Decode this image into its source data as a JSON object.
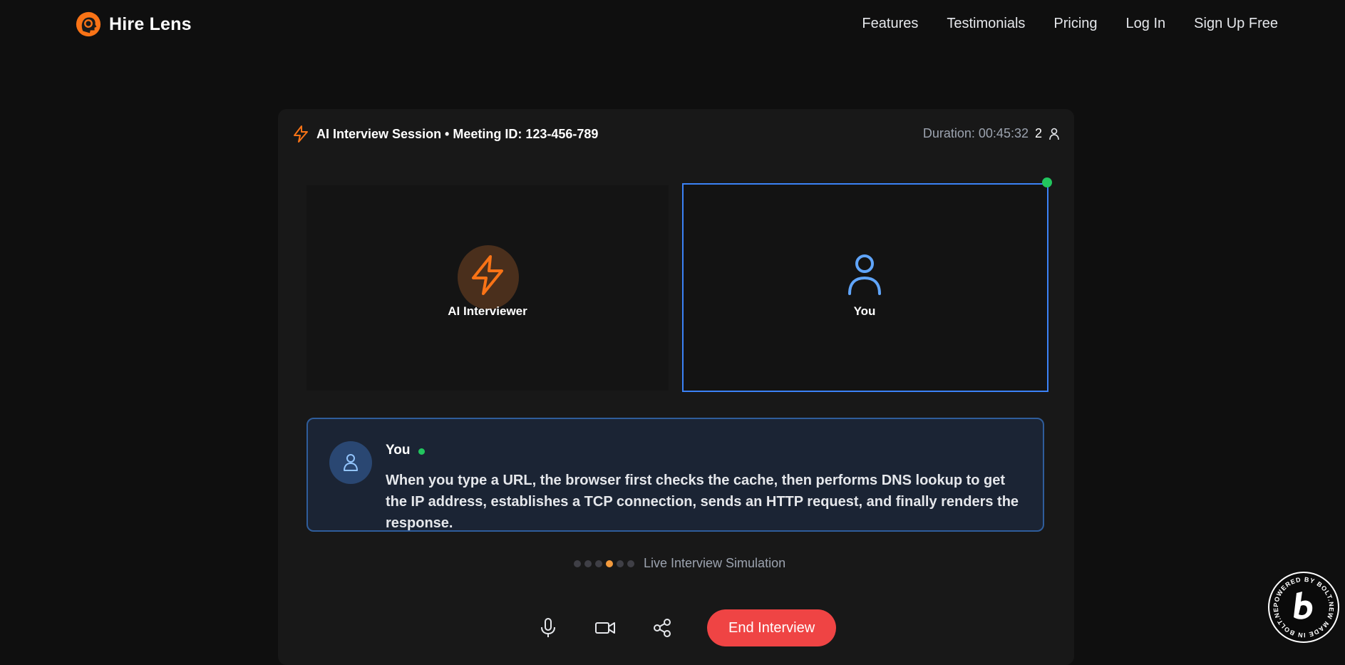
{
  "nav": {
    "brand": "Hire Lens",
    "links": [
      "Features",
      "Testimonials",
      "Pricing",
      "Log In",
      "Sign Up Free"
    ]
  },
  "session": {
    "title": "AI Interview Session • Meeting ID: 123-456-789",
    "duration": "Duration: 00:45:32",
    "participants": "2"
  },
  "tiles": {
    "ai_label": "AI Interviewer",
    "you_label": "You"
  },
  "transcript": {
    "speaker": "You",
    "text": "When you type a URL, the browser first checks the cache, then performs DNS lookup to get the IP address, establishes a TCP connection, sends an HTTP request, and finally renders the response."
  },
  "progress": {
    "active_index": 3,
    "total": 6,
    "label": "Live Interview Simulation"
  },
  "controls": {
    "end_label": "End Interview"
  },
  "badge": {
    "text": "POWERED BY BOLT.NEW MADE IN BOLT.NEW"
  },
  "colors": {
    "accent": "#f97316",
    "primary": "#3b82f6",
    "danger": "#ef4444",
    "live": "#22c55e"
  },
  "icons": [
    "head-logo-icon",
    "lightning-icon",
    "user-icon",
    "microphone-icon",
    "video-icon",
    "share-icon",
    "bolt-b-icon"
  ]
}
